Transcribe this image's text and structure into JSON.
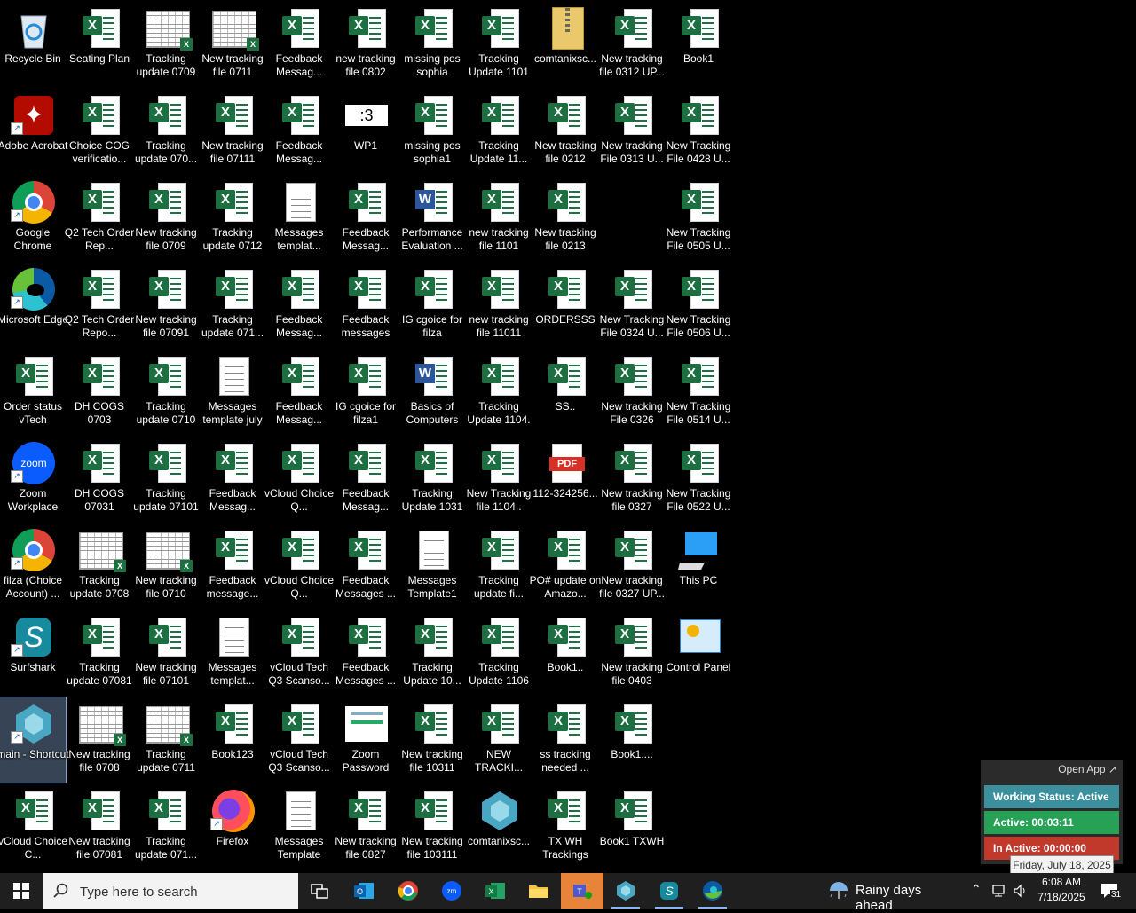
{
  "desktop": {
    "icons": [
      {
        "label": "Recycle Bin",
        "type": "recycle",
        "shortcut": false
      },
      {
        "label": "Seating Plan",
        "type": "excel",
        "shortcut": false
      },
      {
        "label": "Tracking update 0709",
        "type": "thumb",
        "shortcut": false
      },
      {
        "label": "New tracking file 0711",
        "type": "thumb",
        "shortcut": false
      },
      {
        "label": "Feedback Messag...",
        "type": "excel",
        "shortcut": false
      },
      {
        "label": "new tracking file 0802",
        "type": "excel",
        "shortcut": false
      },
      {
        "label": "missing pos sophia",
        "type": "excel",
        "shortcut": false
      },
      {
        "label": "Tracking Update 1101",
        "type": "excel",
        "shortcut": false
      },
      {
        "label": "comtanixsc...",
        "type": "zip",
        "shortcut": false
      },
      {
        "label": "New tracking file 0312 UP...",
        "type": "excel",
        "shortcut": false
      },
      {
        "label": "Book1",
        "type": "excel",
        "shortcut": false
      },
      {
        "label": "Adobe Acrobat",
        "type": "acrobat",
        "shortcut": true
      },
      {
        "label": "Choice COG verificatio...",
        "type": "excel",
        "shortcut": false
      },
      {
        "label": "Tracking update 070...",
        "type": "excel",
        "shortcut": false
      },
      {
        "label": "New tracking file 07111",
        "type": "excel",
        "shortcut": false
      },
      {
        "label": "Feedback Messag...",
        "type": "excel",
        "shortcut": false
      },
      {
        "label": "WP1",
        "type": "wp",
        "shortcut": false
      },
      {
        "label": "missing pos sophia1",
        "type": "excel",
        "shortcut": false
      },
      {
        "label": "Tracking Update 11...",
        "type": "excel",
        "shortcut": false
      },
      {
        "label": "New tracking file 0212",
        "type": "excel",
        "shortcut": false
      },
      {
        "label": "New tracking File 0313 U...",
        "type": "excel",
        "shortcut": false
      },
      {
        "label": "New Tracking File 0428 U...",
        "type": "excel",
        "shortcut": false
      },
      {
        "label": "Google Chrome",
        "type": "chrome",
        "shortcut": true
      },
      {
        "label": "Q2 Tech Order Rep...",
        "type": "excel",
        "shortcut": false
      },
      {
        "label": "New tracking file 0709",
        "type": "excel",
        "shortcut": false
      },
      {
        "label": "Tracking update 0712",
        "type": "excel",
        "shortcut": false
      },
      {
        "label": "Messages templat...",
        "type": "doc",
        "shortcut": false
      },
      {
        "label": "Feedback Messag...",
        "type": "excel",
        "shortcut": false
      },
      {
        "label": "Performance Evaluation ...",
        "type": "word",
        "shortcut": false
      },
      {
        "label": "new tracking file 1101",
        "type": "excel",
        "shortcut": false
      },
      {
        "label": "New tracking file 0213",
        "type": "excel",
        "shortcut": false
      },
      {
        "label": "New Tracking File 0505 U...",
        "type": "excel",
        "shortcut": false
      },
      {
        "label": "Microsoft Edge",
        "type": "edge",
        "shortcut": true
      },
      {
        "label": "Q2 Tech Order Repo...",
        "type": "excel",
        "shortcut": false
      },
      {
        "label": "New tracking file 07091",
        "type": "excel",
        "shortcut": false
      },
      {
        "label": "Tracking update 071...",
        "type": "excel",
        "shortcut": false
      },
      {
        "label": "Feedback Messag...",
        "type": "excel",
        "shortcut": false
      },
      {
        "label": "Feedback messages",
        "type": "excel",
        "shortcut": false
      },
      {
        "label": "IG cgoice for filza",
        "type": "excel",
        "shortcut": false
      },
      {
        "label": "new tracking file 11011",
        "type": "excel",
        "shortcut": false
      },
      {
        "label": "ORDERSSS",
        "type": "excel",
        "shortcut": false
      },
      {
        "label": "New Tracking File 0324 U...",
        "type": "excel",
        "shortcut": false
      },
      {
        "label": "New Tracking File 0506 U...",
        "type": "excel",
        "shortcut": false
      },
      {
        "label": "Order status vTech",
        "type": "excel",
        "shortcut": false
      },
      {
        "label": "DH COGS 0703",
        "type": "excel",
        "shortcut": false
      },
      {
        "label": "Tracking update 0710",
        "type": "excel",
        "shortcut": false
      },
      {
        "label": "Messages template july",
        "type": "doc",
        "shortcut": false
      },
      {
        "label": "Feedback Messag...",
        "type": "excel",
        "shortcut": false
      },
      {
        "label": "IG cgoice for filza1",
        "type": "excel",
        "shortcut": false
      },
      {
        "label": "Basics of Computers",
        "type": "word",
        "shortcut": false
      },
      {
        "label": "Tracking Update 1104.",
        "type": "excel",
        "shortcut": false
      },
      {
        "label": "SS..",
        "type": "excel",
        "shortcut": false
      },
      {
        "label": "New tracking File 0326",
        "type": "excel",
        "shortcut": false
      },
      {
        "label": "New Tracking File 0514 U...",
        "type": "excel",
        "shortcut": false
      },
      {
        "label": "Zoom Workplace",
        "type": "zoom",
        "shortcut": true
      },
      {
        "label": "DH COGS 07031",
        "type": "excel",
        "shortcut": false
      },
      {
        "label": "Tracking update 07101",
        "type": "excel",
        "shortcut": false
      },
      {
        "label": "Feedback Messag...",
        "type": "excel",
        "shortcut": false
      },
      {
        "label": "vCloud Choice Q...",
        "type": "excel",
        "shortcut": false
      },
      {
        "label": "Feedback Messag...",
        "type": "excel",
        "shortcut": false
      },
      {
        "label": "Tracking Update 1031",
        "type": "excel",
        "shortcut": false
      },
      {
        "label": "New Tracking file 1104..",
        "type": "excel",
        "shortcut": false
      },
      {
        "label": "112-324256...",
        "type": "pdf",
        "shortcut": false
      },
      {
        "label": "New tracking file 0327",
        "type": "excel",
        "shortcut": false
      },
      {
        "label": "New Tracking File 0522 U...",
        "type": "excel",
        "shortcut": false
      },
      {
        "label": "filza (Choice Account) ...",
        "type": "chrome",
        "shortcut": true
      },
      {
        "label": "Tracking update 0708",
        "type": "thumb",
        "shortcut": false
      },
      {
        "label": "New tracking file 0710",
        "type": "thumb",
        "shortcut": false
      },
      {
        "label": "Feedback message...",
        "type": "excel",
        "shortcut": false
      },
      {
        "label": "vCloud Choice Q...",
        "type": "excel",
        "shortcut": false
      },
      {
        "label": "Feedback Messages ...",
        "type": "excel",
        "shortcut": false
      },
      {
        "label": "Messages Template1",
        "type": "doc",
        "shortcut": false
      },
      {
        "label": "Tracking update fi...",
        "type": "excel",
        "shortcut": false
      },
      {
        "label": "PO# update on Amazo...",
        "type": "excel",
        "shortcut": false
      },
      {
        "label": "New tracking file 0327 UP...",
        "type": "excel",
        "shortcut": false
      },
      {
        "label": "This PC",
        "type": "pc",
        "shortcut": false
      },
      {
        "label": "Surfshark",
        "type": "surfshark",
        "shortcut": true
      },
      {
        "label": "Tracking update 07081",
        "type": "excel",
        "shortcut": false
      },
      {
        "label": "New tracking file 07101",
        "type": "excel",
        "shortcut": false
      },
      {
        "label": "Messages templat...",
        "type": "doc",
        "shortcut": false
      },
      {
        "label": "vCloud Tech Q3 Scanso...",
        "type": "excel",
        "shortcut": false
      },
      {
        "label": "Feedback Messages ...",
        "type": "excel",
        "shortcut": false
      },
      {
        "label": "Tracking Update 10...",
        "type": "excel",
        "shortcut": false
      },
      {
        "label": "Tracking Update 1106",
        "type": "excel",
        "shortcut": false
      },
      {
        "label": "Book1..",
        "type": "excel",
        "shortcut": false
      },
      {
        "label": "New tracking file 0403",
        "type": "excel",
        "shortcut": false
      },
      {
        "label": "Control Panel",
        "type": "cpanel",
        "shortcut": false
      },
      {
        "label": "main - Shortcut",
        "type": "main",
        "shortcut": true,
        "selected": true
      },
      {
        "label": "New tracking file 0708",
        "type": "thumb",
        "shortcut": false
      },
      {
        "label": "Tracking update 0711",
        "type": "thumb",
        "shortcut": false
      },
      {
        "label": "Book123",
        "type": "excel",
        "shortcut": false
      },
      {
        "label": "vCloud Tech Q3 Scanso...",
        "type": "excel",
        "shortcut": false
      },
      {
        "label": "Zoom Password",
        "type": "img",
        "shortcut": false
      },
      {
        "label": "New tracking file 10311",
        "type": "excel",
        "shortcut": false
      },
      {
        "label": "NEW TRACKI...",
        "type": "excel",
        "shortcut": false
      },
      {
        "label": "ss tracking needed ...",
        "type": "excel",
        "shortcut": false
      },
      {
        "label": "Book1....",
        "type": "excel",
        "shortcut": false
      },
      {
        "label": "vCloud Choice C...",
        "type": "excel",
        "shortcut": false
      },
      {
        "label": "New tracking file 07081",
        "type": "excel",
        "shortcut": false
      },
      {
        "label": "Tracking update 071...",
        "type": "excel",
        "shortcut": false
      },
      {
        "label": "Firefox",
        "type": "firefox",
        "shortcut": true
      },
      {
        "label": "Messages Template",
        "type": "doc",
        "shortcut": false
      },
      {
        "label": "New tracking file 0827",
        "type": "excel",
        "shortcut": false
      },
      {
        "label": "New tracking file 103111",
        "type": "excel",
        "shortcut": false
      },
      {
        "label": "comtanixsc...",
        "type": "main",
        "shortcut": false
      },
      {
        "label": "TX WH Trackings",
        "type": "excel",
        "shortcut": false
      },
      {
        "label": "Book1 TXWH",
        "type": "excel",
        "shortcut": false
      }
    ]
  },
  "widget": {
    "open_app": "Open App ↗",
    "working_status": "Working Status: Active",
    "active": "Active: 00:03:11",
    "inactive": "In Active: 00:00:00",
    "colors": {
      "status": "#3c8f9c",
      "active": "#27a155",
      "inactive": "#c0392b"
    }
  },
  "tooltip": "Friday, July 18, 2025",
  "taskbar": {
    "search_placeholder": "Type here to search",
    "weather": "Rainy days ahead",
    "time": "6:08 AM",
    "date": "7/18/2025",
    "notification_count": "31",
    "apps": [
      "task-view",
      "outlook",
      "chrome",
      "zoom",
      "excel",
      "file-explorer",
      "teams",
      "main-app",
      "surfshark",
      "edge"
    ]
  }
}
